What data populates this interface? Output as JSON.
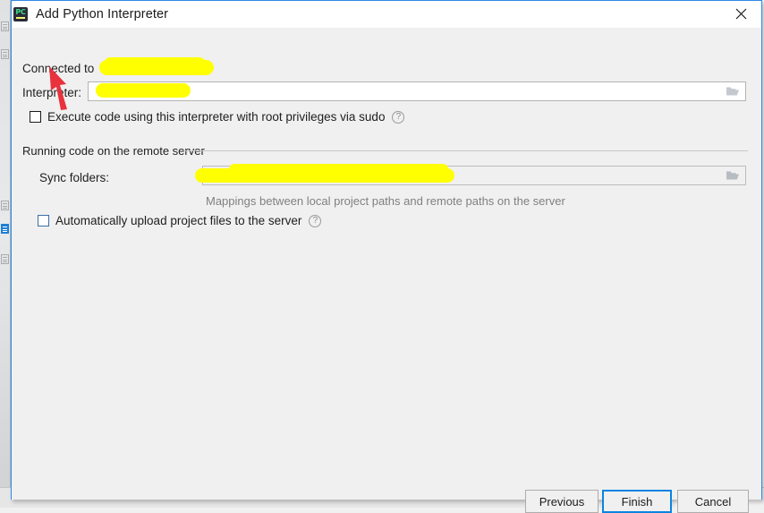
{
  "window": {
    "title": "Add Python Interpreter",
    "app_icon": "pycharm-icon",
    "icon_text": "PC",
    "close_icon": "close-icon",
    "accent_color": "#2e8ae6"
  },
  "form": {
    "connected_to_label": "Connected to",
    "connected_to_value": "",
    "interpreter_label": "Interpreter:",
    "interpreter_value": "",
    "browse_icon": "folder-browse-icon",
    "sudo_checkbox_label": "Execute code using this interpreter with root privileges via sudo",
    "sudo_checkbox_checked": false,
    "help_icon": "help-icon",
    "help_glyph": "?"
  },
  "remote_group": {
    "title": "Running code on the remote server",
    "sync_folders_label": "Sync folders:",
    "sync_folders_value": "",
    "sync_folders_hint": "Mappings between local project paths and remote paths on the server",
    "auto_upload_label": "Automatically upload project files to the server",
    "auto_upload_checked": false
  },
  "footer": {
    "previous_label": "Previous",
    "finish_label": "Finish",
    "cancel_label": "Cancel",
    "default_button": "Finish"
  },
  "annotation": {
    "arrow_color": "#e8323c",
    "arrow_name": "red-pointer-arrow"
  }
}
